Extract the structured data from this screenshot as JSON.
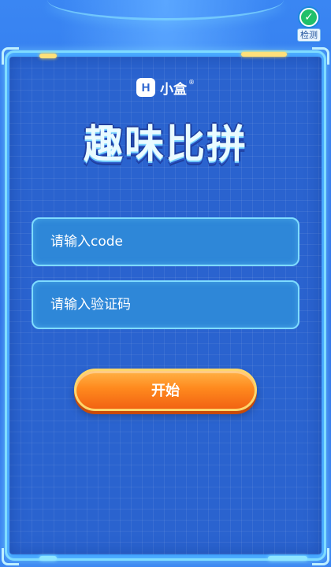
{
  "detect": {
    "label": "检测",
    "icon": "check-icon"
  },
  "brand": {
    "logo_letter": "H",
    "name": "小盒",
    "reg": "®"
  },
  "title": "趣味比拼",
  "form": {
    "code_placeholder": "请输入code",
    "verify_placeholder": "请输入验证码",
    "start_label": "开始"
  },
  "colors": {
    "background": "#2f74e8",
    "panel": "#2a63cf",
    "frame": "#7fdcff",
    "button_top": "#ffb347",
    "button_bottom": "#f26312",
    "button_border": "#ffd66b"
  }
}
